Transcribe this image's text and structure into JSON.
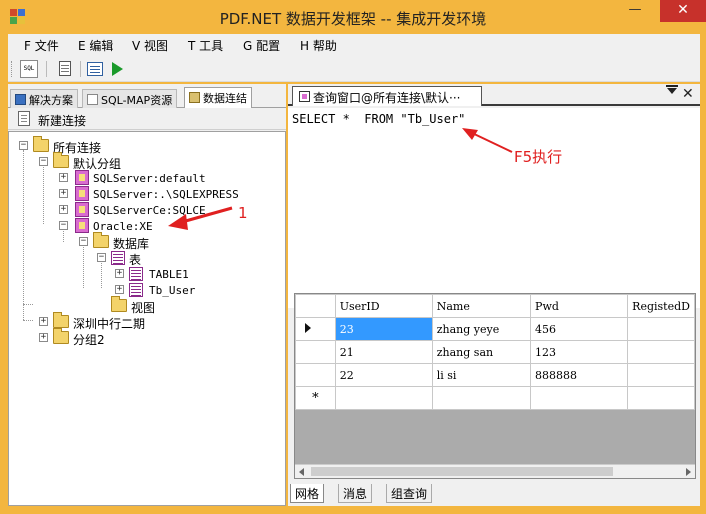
{
  "window": {
    "title": "PDF.NET 数据开发框架 -- 集成开发环境",
    "minimize": "—",
    "maximize": "□",
    "close": "✕"
  },
  "menu": [
    "F 文件",
    "E 编辑",
    "V 视图",
    "T 工具",
    "G 配置",
    "H 帮助"
  ],
  "toolbar": {
    "sql_icon_text": "SQL"
  },
  "left_panel": {
    "tabs": [
      "解决方案",
      "SQL-MAP资源",
      "数据连结"
    ],
    "active_tab": 2,
    "new_connection": "新建连接",
    "tree": {
      "root": "所有连接",
      "default_group": "默认分组",
      "connections": [
        "SQLServer:default",
        "SQLServer:.\\SQLEXPRESS",
        "SQLServerCe:SQLCE",
        "Oracle:XE"
      ],
      "database": "数据库",
      "tables_node": "表",
      "tables": [
        "TABLE1",
        "Tb_User"
      ],
      "views_node": "视图",
      "groups": [
        "深圳中行二期",
        "分组2"
      ]
    }
  },
  "right_panel": {
    "doc_tab_title": "查询窗口@所有连接\\默认···",
    "sql": "SELECT *  FROM \"Tb_User\"",
    "grid": {
      "columns": [
        "UserID",
        "Name",
        "Pwd",
        "RegistedD"
      ],
      "rows": [
        [
          "23",
          "zhang yeye",
          "456",
          ""
        ],
        [
          "21",
          "zhang san",
          "123",
          ""
        ],
        [
          "22",
          "li si",
          "888888",
          ""
        ]
      ],
      "new_row_marker": "*"
    },
    "bottom_tabs": [
      "网格",
      "消息",
      "组查询"
    ],
    "active_bottom_tab": 0
  },
  "annotations": {
    "f5_label": "F5执行",
    "marker_1": "1",
    "color": "#e02020"
  }
}
